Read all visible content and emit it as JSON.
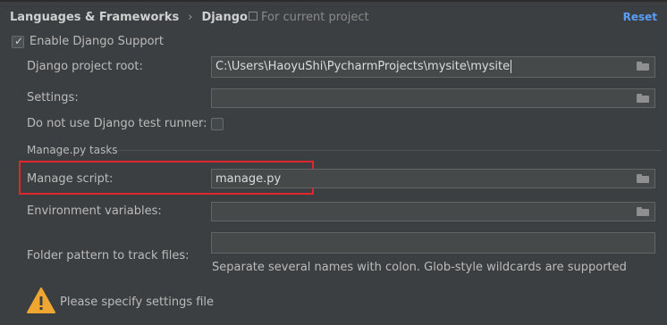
{
  "header": {
    "breadcrumb_parent": "Languages & Frameworks",
    "breadcrumb_separator": "›",
    "breadcrumb_current": "Django",
    "scope_label": "For current project",
    "reset_label": "Reset"
  },
  "enable_support": {
    "label": "Enable Django Support",
    "checked": true
  },
  "fields": {
    "project_root": {
      "label": "Django project root:",
      "value": "C:\\Users\\HaoyuShi\\PycharmProjects\\mysite\\mysite"
    },
    "settings": {
      "label": "Settings:",
      "value": ""
    },
    "no_test_runner": {
      "label": "Do not use Django test runner:",
      "checked": false
    },
    "manage_script": {
      "label": "Manage script:",
      "value": "manage.py"
    },
    "env_vars": {
      "label": "Environment variables:",
      "value": ""
    },
    "folder_pattern": {
      "label": "Folder pattern to track files:",
      "value": ""
    }
  },
  "section_title": "Manage.py tasks",
  "hint": "Separate several names with colon. Glob-style wildcards are supported",
  "warning": {
    "icon": "warning-icon",
    "text": "Please specify settings file"
  },
  "colors": {
    "background": "#3c3f41",
    "link": "#589df6",
    "highlight": "#e0262b",
    "warning": "#f0a732"
  }
}
